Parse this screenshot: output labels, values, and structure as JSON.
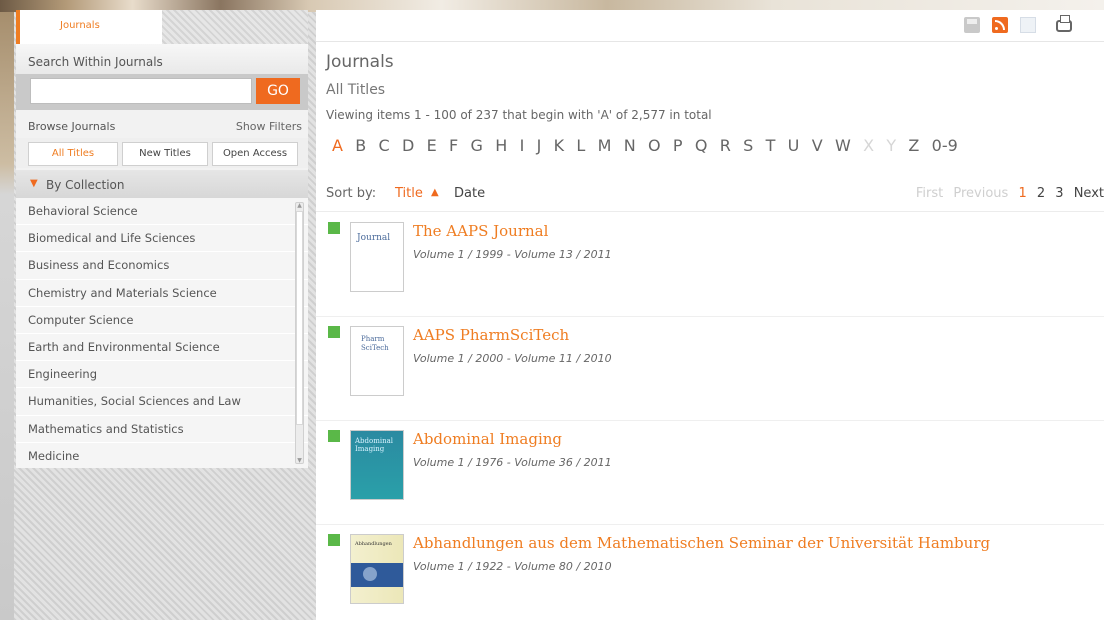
{
  "sidebar": {
    "tab_label": "Journals",
    "search_heading": "Search Within Journals",
    "search_value": "",
    "search_placeholder": "",
    "go_label": "GO",
    "browse_label": "Browse Journals",
    "show_filters_label": "Show Filters",
    "filter_buttons": [
      "All Titles",
      "New Titles",
      "Open Access"
    ],
    "collection_heading": "By Collection",
    "collections": [
      "Behavioral Science",
      "Biomedical and Life Sciences",
      "Business and Economics",
      "Chemistry and Materials Science",
      "Computer Science",
      "Earth and Environmental Science",
      "Engineering",
      "Humanities, Social Sciences and Law",
      "Mathematics and Statistics",
      "Medicine"
    ]
  },
  "toolbar": {
    "icons": [
      "save-icon",
      "rss-icon",
      "document-icon",
      "print-icon"
    ]
  },
  "main": {
    "title": "Journals",
    "subtitle": "All Titles",
    "viewing": "Viewing items 1 - 100 of 237 that begin with 'A' of 2,577 in total",
    "alphabet": [
      "A",
      "B",
      "C",
      "D",
      "E",
      "F",
      "G",
      "H",
      "I",
      "J",
      "K",
      "L",
      "M",
      "N",
      "O",
      "P",
      "Q",
      "R",
      "S",
      "T",
      "U",
      "V",
      "W",
      "X",
      "Y",
      "Z",
      "0-9"
    ],
    "alphabet_selected": "A",
    "alphabet_disabled": [
      "X",
      "Y"
    ],
    "sort_label": "Sort by:",
    "sort_title": "Title",
    "sort_arrow": "▲",
    "sort_date": "Date",
    "pager": {
      "first": "First",
      "previous": "Previous",
      "pages": [
        "1",
        "2",
        "3"
      ],
      "current": "1",
      "next": "Next"
    },
    "results": [
      {
        "title": "The AAPS Journal",
        "volumes": "Volume 1 / 1999 - Volume 13 / 2011",
        "cover_text": "Journal"
      },
      {
        "title": "AAPS PharmSciTech",
        "volumes": "Volume 1 / 2000 - Volume 11 / 2010",
        "cover_text": "Pharm SciTech"
      },
      {
        "title": "Abdominal Imaging",
        "volumes": "Volume 1 / 1976 - Volume 36 / 2011",
        "cover_text": "Abdominal Imaging"
      },
      {
        "title": "Abhandlungen aus dem Mathematischen Seminar der Universität Hamburg",
        "volumes": "Volume 1 / 1922 - Volume 80 / 2010",
        "cover_text": "Abhandlungen"
      }
    ]
  },
  "colors": {
    "accent": "#ef6a1f",
    "marker": "#5ab848"
  }
}
